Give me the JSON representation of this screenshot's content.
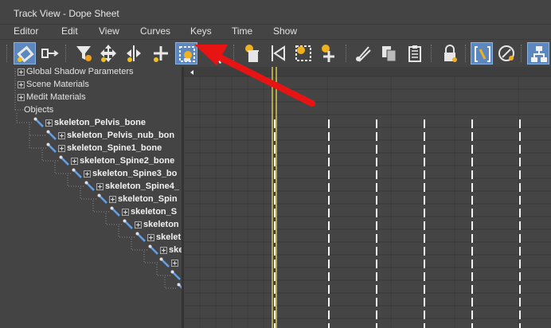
{
  "window": {
    "title": "Track View - Dope Sheet"
  },
  "menu": {
    "items": [
      "Editor",
      "Edit",
      "View",
      "Curves",
      "Keys",
      "Time",
      "Show"
    ]
  },
  "toolbar": {
    "buttons": [
      {
        "name": "filter-icon",
        "active": true
      },
      {
        "name": "edit-ranges-icon",
        "active": false
      },
      {
        "name": "filter-funnel-icon",
        "active": false
      },
      {
        "name": "move-keys-icon",
        "active": false
      },
      {
        "name": "slide-keys-icon",
        "active": false
      },
      {
        "name": "add-keys-icon",
        "active": false
      },
      {
        "name": "select-time-icon",
        "active": true
      },
      {
        "name": "select-keys-by-time-icon",
        "active": false
      },
      {
        "name": "delete-time-icon",
        "active": false
      },
      {
        "name": "reverse-time-icon",
        "active": false
      },
      {
        "name": "scale-time-icon",
        "active": false
      },
      {
        "name": "insert-time-icon",
        "active": false
      },
      {
        "name": "cut-icon",
        "active": false
      },
      {
        "name": "copy-icon",
        "active": false
      },
      {
        "name": "paste-icon",
        "active": false
      },
      {
        "name": "lock-selection-icon",
        "active": false
      },
      {
        "name": "snap-frames-icon",
        "active": true
      },
      {
        "name": "show-keyable-icons-icon",
        "active": false
      },
      {
        "name": "hierarchy-icon",
        "active": true
      }
    ]
  },
  "tree": {
    "items": [
      {
        "label": "Global Shadow Parameters",
        "bold": false,
        "expander": true
      },
      {
        "label": "Scene Materials",
        "bold": false,
        "expander": true
      },
      {
        "label": "Medit Materials",
        "bold": false,
        "expander": true
      },
      {
        "label": "Objects",
        "bold": false,
        "expander": false
      },
      {
        "label": "skeleton_Pelvis_bone",
        "bold": true,
        "expander": true
      },
      {
        "label": "skeleton_Pelvis_nub_bon",
        "bold": true,
        "expander": true
      },
      {
        "label": "skeleton_Spine1_bone",
        "bold": true,
        "expander": true
      },
      {
        "label": "skeleton_Spine2_bone",
        "bold": true,
        "expander": true
      },
      {
        "label": "skeleton_Spine3_bo",
        "bold": true,
        "expander": true
      },
      {
        "label": "skeleton_Spine4_",
        "bold": true,
        "expander": true
      },
      {
        "label": "skeleton_Spin",
        "bold": true,
        "expander": true
      },
      {
        "label": "skeleton_S",
        "bold": true,
        "expander": true
      },
      {
        "label": "skeleton",
        "bold": true,
        "expander": true
      },
      {
        "label": "skelet",
        "bold": true,
        "expander": true
      },
      {
        "label": "ske",
        "bold": true,
        "expander": true
      },
      {
        "label": "",
        "bold": true,
        "expander": true
      },
      {
        "label": "",
        "bold": true,
        "expander": false
      },
      {
        "label": "",
        "bold": true,
        "expander": false
      }
    ]
  },
  "colors": {
    "accent": "#5c88bf",
    "time_slider": "#d8c850",
    "arrow": "#e81414"
  }
}
